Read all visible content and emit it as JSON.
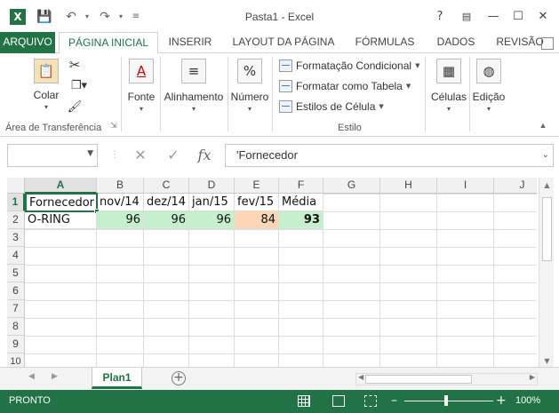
{
  "window": {
    "title": "Pasta1 - Excel"
  },
  "ribbon_tabs": [
    "ARQUIVO",
    "PÁGINA INICIAL",
    "INSERIR",
    "LAYOUT DA PÁGINA",
    "FÓRMULAS",
    "DADOS",
    "REVISÃO"
  ],
  "ribbon": {
    "clipboard": {
      "paste_label": "Colar",
      "group_label": "Área de Transferência"
    },
    "font_label": "Fonte",
    "alignment_label": "Alinhamento",
    "number_label": "Número",
    "styles": {
      "conditional": "Formatação Condicional",
      "as_table": "Formatar como Tabela",
      "cell_styles": "Estilos de Célula",
      "group_label": "Estilo"
    },
    "cells_label": "Células",
    "editing_label": "Edição"
  },
  "formula_bar": {
    "name_box": "",
    "content": "'Fornecedor"
  },
  "grid": {
    "columns": [
      "A",
      "B",
      "C",
      "D",
      "E",
      "F",
      "G",
      "H",
      "I",
      "J"
    ],
    "rows": [
      "1",
      "2",
      "3",
      "4",
      "5",
      "6",
      "7",
      "8",
      "9",
      "10"
    ],
    "header_row": [
      "Fornecedor",
      "nov/14",
      "dez/14",
      "jan/15",
      "fev/15",
      "Média"
    ],
    "data_row": [
      "O-RING",
      "96",
      "96",
      "96",
      "84",
      "93"
    ],
    "colors": {
      "green": "#c6efce",
      "orange": "#fcd5b4"
    }
  },
  "sheet_tabs": [
    "Plan1"
  ],
  "status": {
    "mode": "PRONTO",
    "zoom": "100%"
  },
  "colors": {
    "accent": "#217346"
  }
}
